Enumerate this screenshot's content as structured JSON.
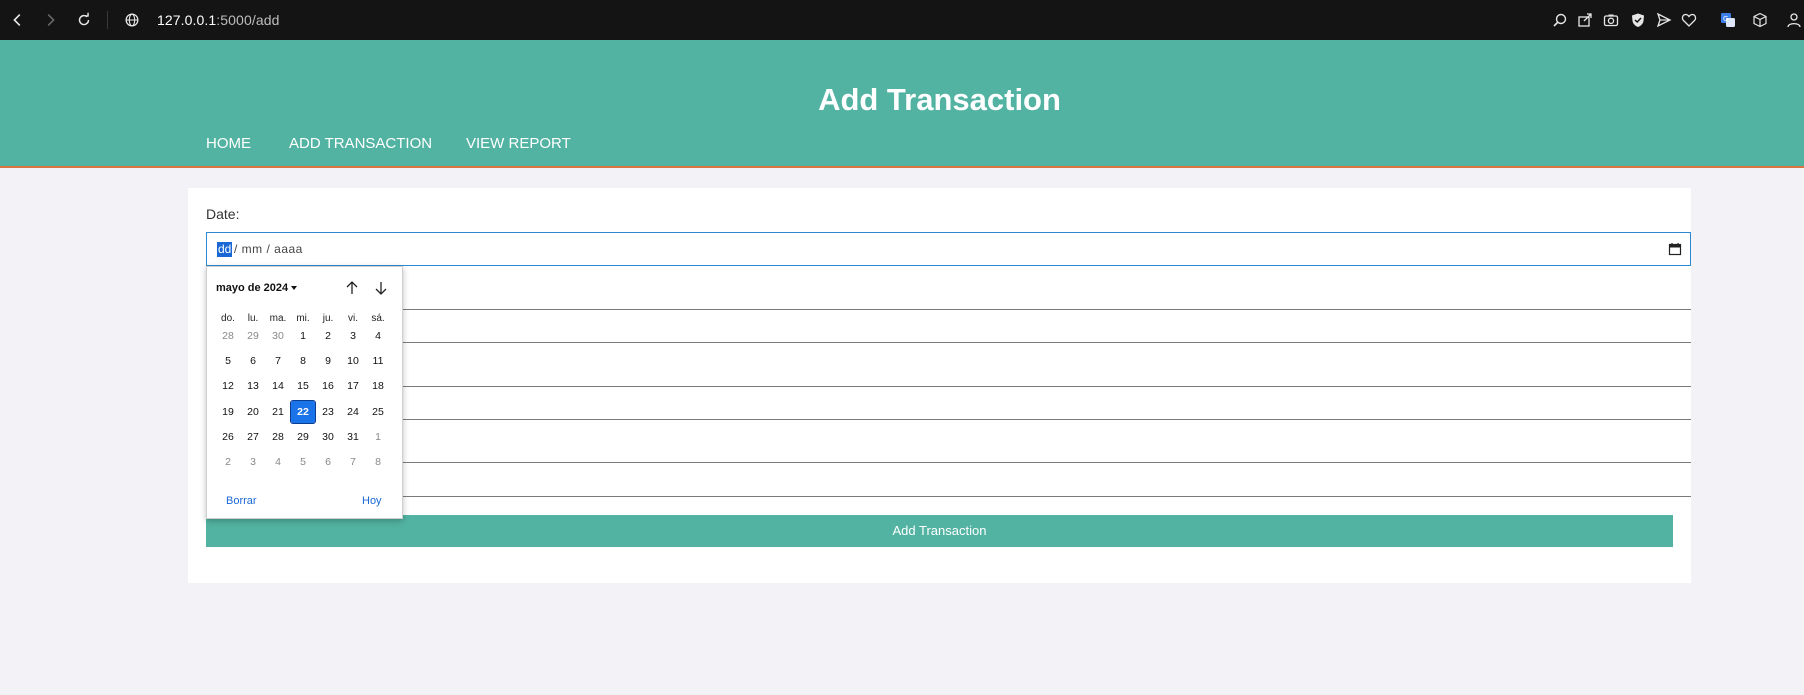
{
  "browser": {
    "url_host": "127.0.0.1",
    "url_path": ":5000/add"
  },
  "header": {
    "title": "Add Transaction",
    "nav": [
      {
        "label": "HOME"
      },
      {
        "label": "ADD TRANSACTION"
      },
      {
        "label": "VIEW REPORT"
      }
    ]
  },
  "form": {
    "date_label": "Date:",
    "date_placeholder_dd": "dd",
    "date_placeholder_rest": "/ mm / aaaa",
    "submit_label": "Add Transaction"
  },
  "datepicker": {
    "month_label": "mayo de 2024",
    "weekdays": [
      "do.",
      "lu.",
      "ma.",
      "mi.",
      "ju.",
      "vi.",
      "sá."
    ],
    "weeks": [
      [
        {
          "d": "28",
          "m": true
        },
        {
          "d": "29",
          "m": true
        },
        {
          "d": "30",
          "m": true
        },
        {
          "d": "1"
        },
        {
          "d": "2"
        },
        {
          "d": "3"
        },
        {
          "d": "4"
        }
      ],
      [
        {
          "d": "5"
        },
        {
          "d": "6"
        },
        {
          "d": "7"
        },
        {
          "d": "8"
        },
        {
          "d": "9"
        },
        {
          "d": "10"
        },
        {
          "d": "11"
        }
      ],
      [
        {
          "d": "12"
        },
        {
          "d": "13"
        },
        {
          "d": "14"
        },
        {
          "d": "15"
        },
        {
          "d": "16"
        },
        {
          "d": "17"
        },
        {
          "d": "18"
        }
      ],
      [
        {
          "d": "19"
        },
        {
          "d": "20"
        },
        {
          "d": "21"
        },
        {
          "d": "22",
          "sel": true
        },
        {
          "d": "23"
        },
        {
          "d": "24"
        },
        {
          "d": "25"
        }
      ],
      [
        {
          "d": "26"
        },
        {
          "d": "27"
        },
        {
          "d": "28"
        },
        {
          "d": "29"
        },
        {
          "d": "30"
        },
        {
          "d": "31"
        },
        {
          "d": "1",
          "m": true
        }
      ],
      [
        {
          "d": "2",
          "m": true
        },
        {
          "d": "3",
          "m": true
        },
        {
          "d": "4",
          "m": true
        },
        {
          "d": "5",
          "m": true
        },
        {
          "d": "6",
          "m": true
        },
        {
          "d": "7",
          "m": true
        },
        {
          "d": "8",
          "m": true
        }
      ]
    ],
    "clear_label": "Borrar",
    "today_label": "Hoy"
  },
  "colors": {
    "header_bg": "#52b3a2",
    "header_border": "#d8743f",
    "selected_day": "#1a73e8"
  }
}
